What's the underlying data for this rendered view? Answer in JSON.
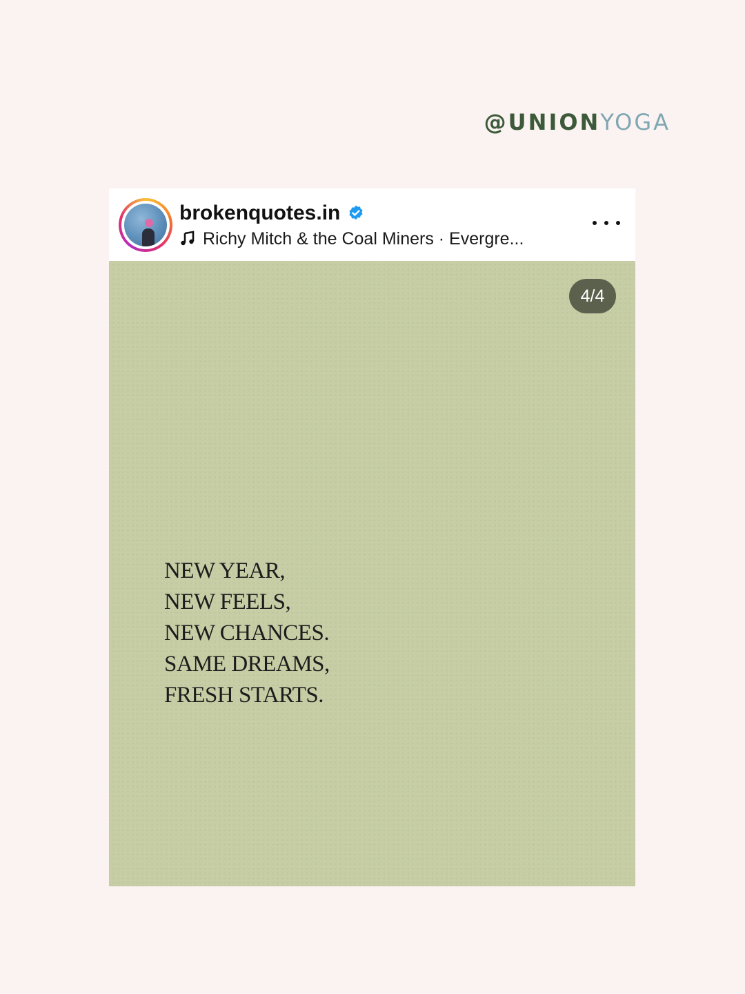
{
  "watermark": {
    "part1": "@UNION",
    "part2": "YOGA",
    "color1": "#3c5a3a",
    "color2": "#7fa6b3"
  },
  "post": {
    "username": "brokenquotes.in",
    "verified": true,
    "verified_icon": "verified-badge-icon",
    "music_icon": "music-note-icon",
    "music_text": "Richy Mitch & the Coal Miners · Evergre...",
    "more_icon": "more-options-icon",
    "avatar_icon": "profile-avatar",
    "slide_counter": "4/4",
    "quote_lines": [
      "NEW YEAR,",
      "NEW FEELS,",
      "NEW CHANCES.",
      "SAME DREAMS,",
      "FRESH STARTS."
    ],
    "image_bg_color": "#c6cda4"
  }
}
